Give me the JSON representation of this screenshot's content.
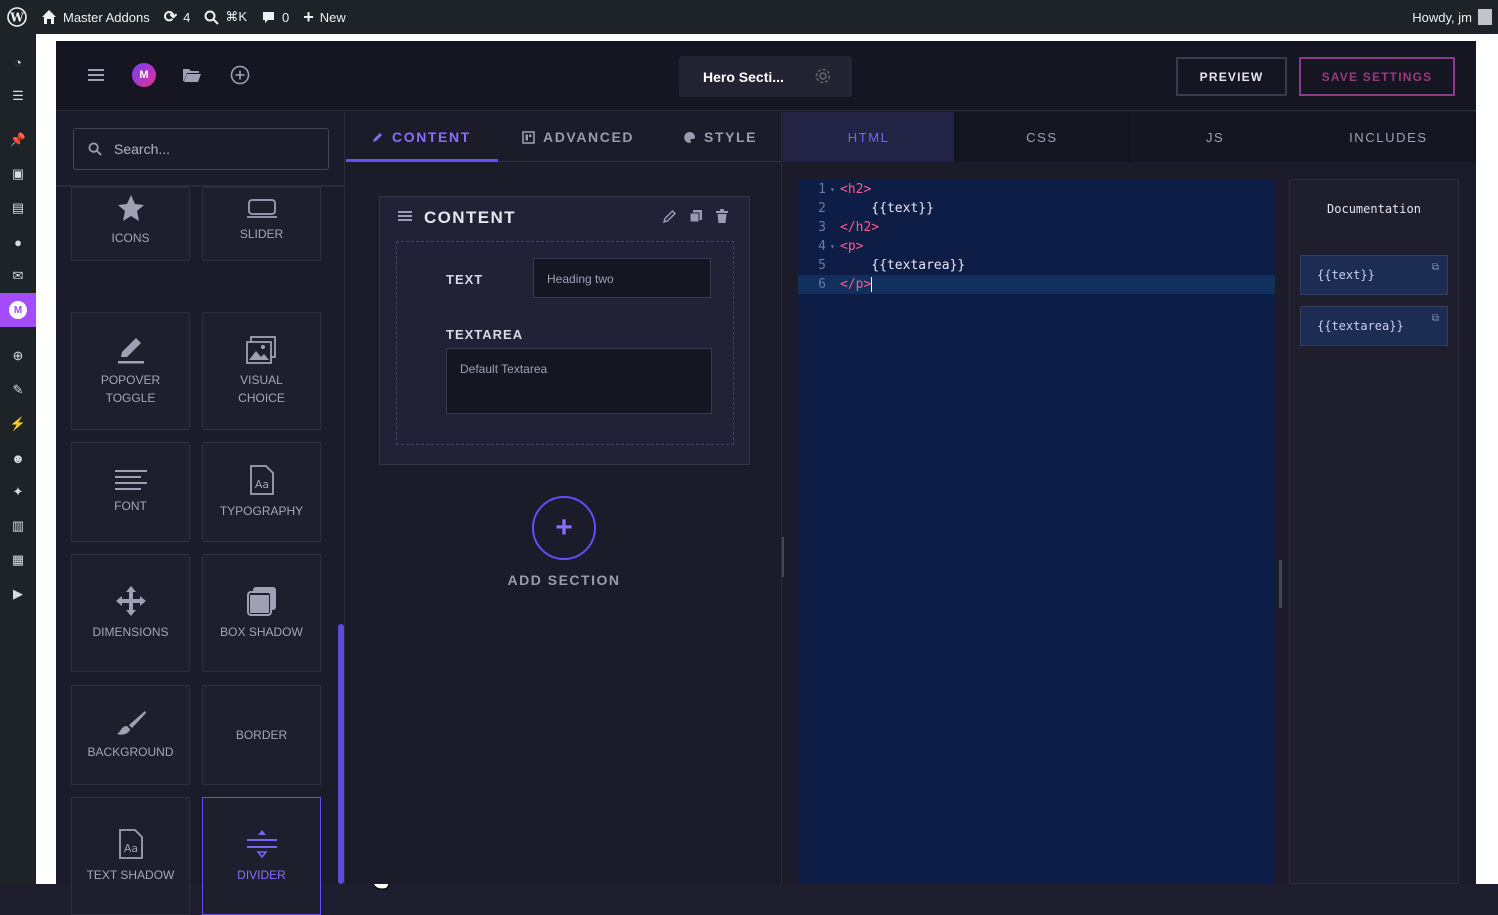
{
  "adminbar": {
    "site_name": "Master Addons",
    "updates_count": "4",
    "search_shortcut": "⌘K",
    "comments_count": "0",
    "new_label": "New",
    "greeting": "Howdy, jm"
  },
  "wp_sidebar": {
    "icons": [
      "dashboard-icon",
      "elementor-icon",
      "pin-icon",
      "media-icon",
      "pages-icon",
      "comments-icon",
      "mail-icon",
      "master-addons-icon",
      "plus-icon",
      "brush-icon",
      "plugin-icon",
      "users-icon",
      "wrench-icon",
      "settings-icon",
      "table-icon",
      "play-icon"
    ]
  },
  "topbar": {
    "template_name": "Hero Secti...",
    "preview_label": "PREVIEW",
    "save_label": "SAVE SETTINGS",
    "logo_letter": "M"
  },
  "left_panel": {
    "search_placeholder": "Search...",
    "controls": [
      {
        "label": "ICONS",
        "icon": "star-icon"
      },
      {
        "label": "SLIDER",
        "icon": "slider-icon"
      },
      {
        "label": "POPOVER TOGGLE",
        "icon": "pencil-icon"
      },
      {
        "label": "VISUAL CHOICE",
        "icon": "images-icon"
      },
      {
        "label": "FONT",
        "icon": "lines-icon"
      },
      {
        "label": "TYPOGRAPHY",
        "icon": "typography-icon"
      },
      {
        "label": "DIMENSIONS",
        "icon": "move-icon"
      },
      {
        "label": "BOX SHADOW",
        "icon": "box-shadow-icon"
      },
      {
        "label": "BACKGROUND",
        "icon": "brush-icon"
      },
      {
        "label": "BORDER",
        "icon": "border-icon"
      },
      {
        "label": "TEXT SHADOW",
        "icon": "text-shadow-icon"
      },
      {
        "label": "DIVIDER",
        "icon": "divider-icon"
      }
    ]
  },
  "mid_panel": {
    "tabs": [
      {
        "label": "CONTENT",
        "icon": "pencil-icon"
      },
      {
        "label": "ADVANCED",
        "icon": "advanced-icon"
      },
      {
        "label": "STYLE",
        "icon": "palette-icon"
      }
    ],
    "section": {
      "title": "CONTENT",
      "fields": [
        {
          "label": "TEXT",
          "value": "Heading two"
        },
        {
          "label": "TEXTAREA",
          "value": "Default Textarea"
        }
      ]
    },
    "add_section_label": "ADD SECTION"
  },
  "code_panel": {
    "tabs": [
      "HTML",
      "CSS",
      "JS",
      "INCLUDES"
    ],
    "active_tab": "HTML",
    "lines": [
      {
        "n": "1",
        "fold": true,
        "tag": "<h2>",
        "text": ""
      },
      {
        "n": "2",
        "fold": false,
        "tag": "",
        "text": "    {{text}}"
      },
      {
        "n": "3",
        "fold": false,
        "tag": "</h2>",
        "text": ""
      },
      {
        "n": "4",
        "fold": true,
        "tag": "<p>",
        "text": ""
      },
      {
        "n": "5",
        "fold": false,
        "tag": "",
        "text": "    {{textarea}}"
      },
      {
        "n": "6",
        "fold": false,
        "tag": "</p>",
        "text": ""
      }
    ],
    "documentation_title": "Documentation",
    "doc_items": [
      "{{text}}",
      "{{textarea}}"
    ]
  }
}
